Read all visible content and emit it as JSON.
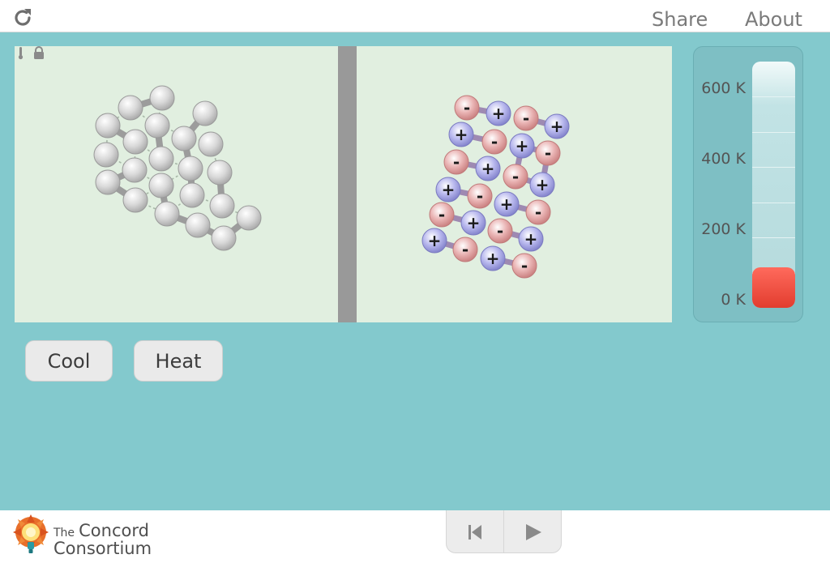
{
  "header": {
    "share_label": "Share",
    "about_label": "About",
    "reload_icon": "reload-icon"
  },
  "simulation": {
    "left_panel": "neutral atoms solid",
    "right_panel": "ionic lattice",
    "icons": [
      "thermometer-icon",
      "lock-icon"
    ],
    "ion_signs": {
      "positive": "+",
      "negative": "-"
    },
    "colors": {
      "background": "#e1efe0",
      "divider": "#999999",
      "atom": "#d6d6d6",
      "positive_ion": "#8a8ad6",
      "negative_ion": "#d68a8a"
    }
  },
  "thermometer": {
    "ticks": [
      {
        "label": "600 K",
        "value": 600
      },
      {
        "label": "400 K",
        "value": 400
      },
      {
        "label": "200 K",
        "value": 200
      },
      {
        "label": "0 K",
        "value": 0
      }
    ],
    "max_value": 700,
    "current_value": 95,
    "fill_color": "#e84a3c"
  },
  "controls": {
    "cool_label": "Cool",
    "heat_label": "Heat"
  },
  "footer": {
    "logo_the": "The",
    "logo_concord": "Concord",
    "logo_consortium": "Consortium"
  },
  "playback": {
    "reset_icon": "reset-icon",
    "play_icon": "play-icon"
  }
}
